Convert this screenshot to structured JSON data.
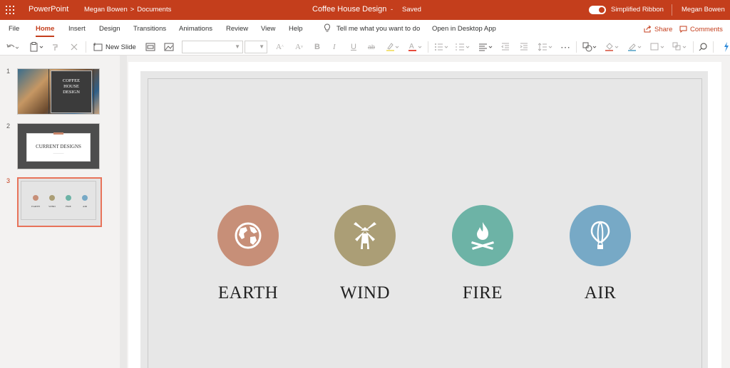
{
  "titlebar": {
    "app_name": "PowerPoint",
    "breadcrumb_user": "Megan Bowen",
    "breadcrumb_sep": ">",
    "breadcrumb_folder": "Documents",
    "doc_title": "Coffee House Design",
    "title_sep": "-",
    "save_status": "Saved",
    "simplified_ribbon_label": "Simplified Ribbon",
    "simplified_ribbon_on": true,
    "user_name": "Megan Bowen",
    "bar_color": "#c43e1c"
  },
  "tabs": [
    "File",
    "Home",
    "Insert",
    "Design",
    "Transitions",
    "Animations",
    "Review",
    "View",
    "Help"
  ],
  "active_tab": "Home",
  "tell_me": "Tell me what you want to do",
  "open_desktop": "Open in Desktop App",
  "share_label": "Share",
  "comments_label": "Comments",
  "ribbon": {
    "new_slide_label": "New Slide",
    "font_name": "",
    "font_size": ""
  },
  "thumbnails": {
    "numbers": [
      "1",
      "2",
      "3"
    ],
    "slide1_title_lines": [
      "COFFEE",
      "HOUSE",
      "DESIGN"
    ],
    "slide2_title": "CURRENT DESIGNS",
    "slide3_labels": [
      "EARTH",
      "WIND",
      "FIRE",
      "AIR"
    ],
    "selected": 3
  },
  "slide": {
    "items": [
      {
        "label": "EARTH",
        "color": "#c78f78",
        "icon": "globe-icon"
      },
      {
        "label": "WIND",
        "color": "#ab9e76",
        "icon": "windmill-icon"
      },
      {
        "label": "FIRE",
        "color": "#6db3a6",
        "icon": "campfire-icon"
      },
      {
        "label": "AIR",
        "color": "#77a9c6",
        "icon": "hot-air-balloon-icon"
      }
    ]
  },
  "colors": {
    "accent": "#c43e1c",
    "selection_outline": "#e8735a",
    "slide_bg": "#e7e7e7"
  }
}
